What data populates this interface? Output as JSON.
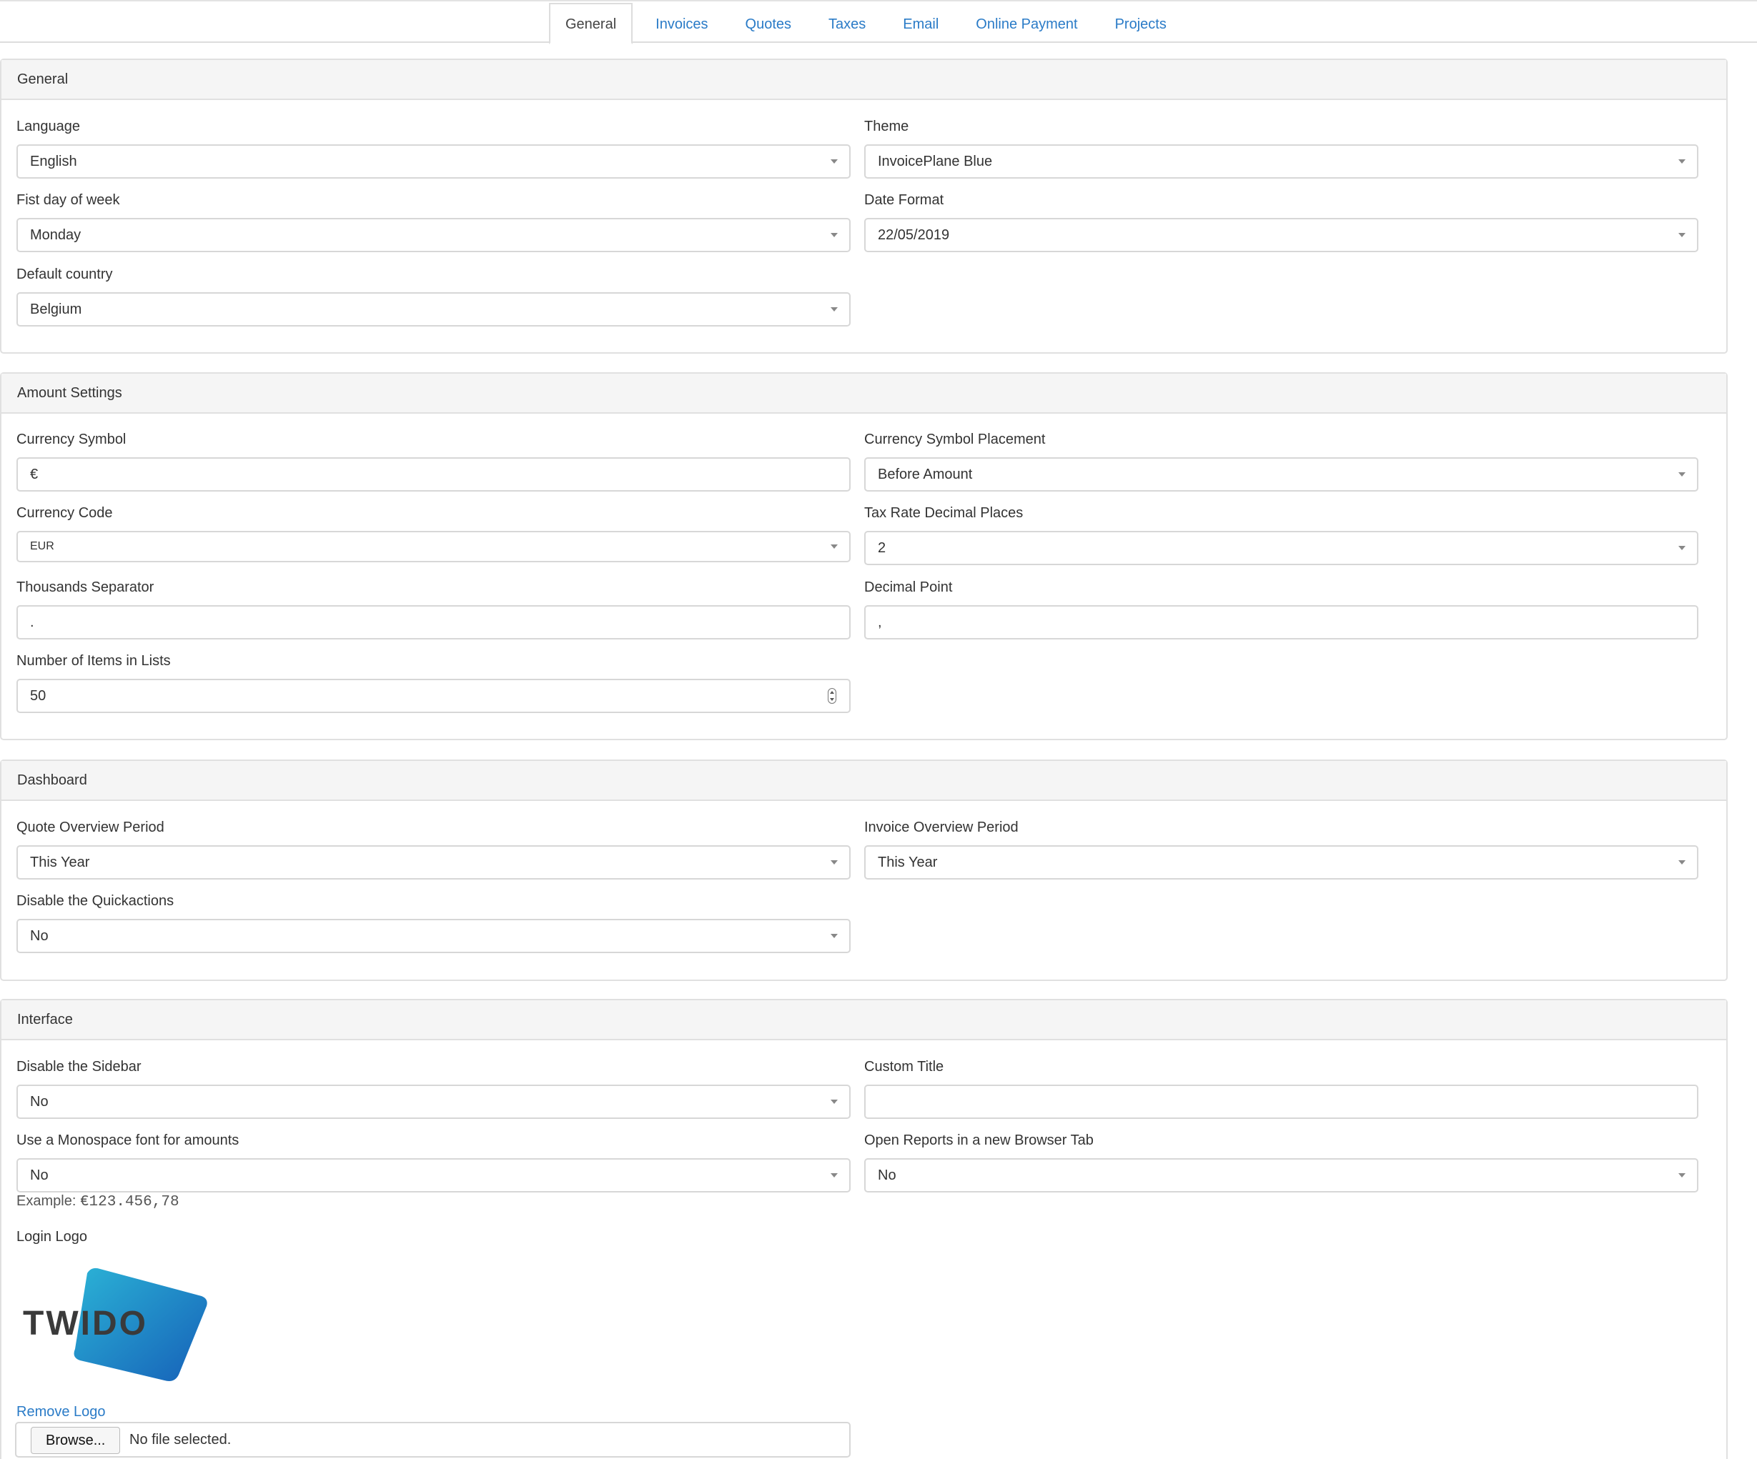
{
  "tabs": [
    {
      "label": "General",
      "active": true
    },
    {
      "label": "Invoices",
      "active": false
    },
    {
      "label": "Quotes",
      "active": false
    },
    {
      "label": "Taxes",
      "active": false
    },
    {
      "label": "Email",
      "active": false
    },
    {
      "label": "Online Payment",
      "active": false
    },
    {
      "label": "Projects",
      "active": false
    }
  ],
  "general": {
    "heading": "General",
    "language": {
      "label": "Language",
      "value": "English"
    },
    "theme": {
      "label": "Theme",
      "value": "InvoicePlane Blue"
    },
    "first_day": {
      "label": "Fist day of week",
      "value": "Monday"
    },
    "date_format": {
      "label": "Date Format",
      "value": "22/05/2019"
    },
    "default_country": {
      "label": "Default country",
      "value": "Belgium"
    }
  },
  "amount": {
    "heading": "Amount Settings",
    "currency_symbol": {
      "label": "Currency Symbol",
      "value": "€"
    },
    "symbol_placement": {
      "label": "Currency Symbol Placement",
      "value": "Before Amount"
    },
    "currency_code": {
      "label": "Currency Code",
      "value": "EUR"
    },
    "tax_decimals": {
      "label": "Tax Rate Decimal Places",
      "value": "2"
    },
    "thousands_sep": {
      "label": "Thousands Separator",
      "value": "."
    },
    "decimal_point": {
      "label": "Decimal Point",
      "value": ","
    },
    "items_in_lists": {
      "label": "Number of Items in Lists",
      "value": "50"
    }
  },
  "dashboard": {
    "heading": "Dashboard",
    "quote_period": {
      "label": "Quote Overview Period",
      "value": "This Year"
    },
    "invoice_period": {
      "label": "Invoice Overview Period",
      "value": "This Year"
    },
    "quickactions": {
      "label": "Disable the Quickactions",
      "value": "No"
    }
  },
  "interface": {
    "heading": "Interface",
    "disable_sidebar": {
      "label": "Disable the Sidebar",
      "value": "No"
    },
    "custom_title": {
      "label": "Custom Title",
      "value": ""
    },
    "monospace": {
      "label": "Use a Monospace font for amounts",
      "value": "No"
    },
    "reports_new_tab": {
      "label": "Open Reports in a new Browser Tab",
      "value": "No"
    },
    "example_prefix": "Example:",
    "example_value": "€123.456,78",
    "login_logo": {
      "label": "Login Logo",
      "logo_text": "TWIDO"
    },
    "remove_logo": "Remove Logo",
    "browse_label": "Browse...",
    "file_status": "No file selected."
  },
  "colors": {
    "link": "#2a7bc7",
    "logo_blue_light": "#2bb3d6",
    "logo_blue_dark": "#1660b8",
    "logo_text": "#3a3a3a"
  }
}
